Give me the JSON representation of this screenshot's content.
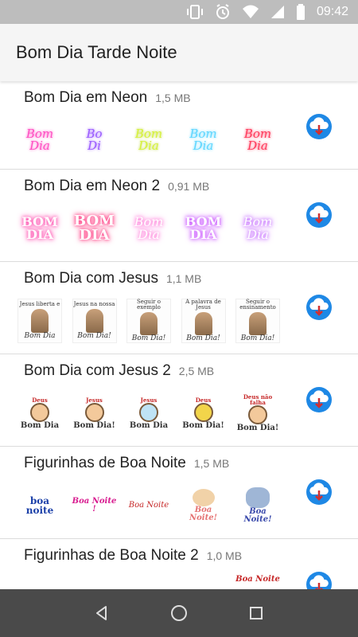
{
  "status": {
    "time": "09:42"
  },
  "app": {
    "title": "Bom Dia Tarde Noite"
  },
  "packs": [
    {
      "name": "Bom Dia em Neon",
      "size": "1,5 MB",
      "stickers": [
        {
          "l1": "Bom",
          "l2": "Dia",
          "color": "#ff4fc3"
        },
        {
          "l1": "Bo",
          "l2": "Di",
          "color": "#9b5cff"
        },
        {
          "l1": "Bom",
          "l2": "Dia",
          "color": "#d6f23a"
        },
        {
          "l1": "Bom",
          "l2": "Dia",
          "color": "#5ed6ff"
        },
        {
          "l1": "Bom",
          "l2": "Dia",
          "color": "#ff3b5c"
        }
      ]
    },
    {
      "name": "Bom Dia em Neon 2",
      "size": "0,91 MB",
      "stickers": [
        {
          "l1": "BOM",
          "l2": "DIA",
          "color": "#ff3ea8"
        },
        {
          "l1": "BOM",
          "l2": "DIA",
          "color": "#ff2f7a"
        },
        {
          "l1": "Bom",
          "l2": "Dia",
          "color": "#ff5fd0"
        },
        {
          "l1": "BOM",
          "l2": "DIA",
          "color": "#c445ff"
        },
        {
          "l1": "Bom",
          "l2": "Dia",
          "color": "#b94dff"
        }
      ]
    },
    {
      "name": "Bom Dia com Jesus",
      "size": "1,1 MB",
      "stickers": [
        {
          "l1": "Jesus liberta e",
          "l2": "Bom Dia"
        },
        {
          "l1": "Jesus na nossa",
          "l2": "Bom Dia!"
        },
        {
          "l1": "Seguir o exemplo",
          "l2": "Bom Dia!"
        },
        {
          "l1": "A palavra de Jesus",
          "l2": "Bom Dia!"
        },
        {
          "l1": "Seguir o ensinamento",
          "l2": "Bom Dia!"
        }
      ]
    },
    {
      "name": "Bom Dia com Jesus 2",
      "size": "2,5 MB",
      "stickers": [
        {
          "l1": "Deus",
          "l2": "Bom Dia"
        },
        {
          "l1": "Jesus",
          "l2": "Bom Dia!"
        },
        {
          "l1": "Jesus",
          "l2": "Bom Dia"
        },
        {
          "l1": "Deus",
          "l2": "Bom Dia!"
        },
        {
          "l1": "Deus não falha",
          "l2": "Bom Dia!"
        }
      ]
    },
    {
      "name": "Figurinhas de Boa Noite",
      "size": "1,5 MB",
      "stickers": [
        {
          "l1": "",
          "l2": "boa noite",
          "color": "#1a3fa8"
        },
        {
          "l1": "",
          "l2": "Boa Noite !",
          "color": "#d81b8f"
        },
        {
          "l1": "",
          "l2": "Boa Noite",
          "color": "#c62828"
        },
        {
          "l1": "",
          "l2": "Boa Noite!",
          "color": "#e57373"
        },
        {
          "l1": "",
          "l2": "Boa Noite!",
          "color": "#3949ab"
        }
      ]
    },
    {
      "name": "Figurinhas de Boa Noite 2",
      "size": "1,0 MB",
      "stickers": [
        {
          "l1": "",
          "l2": "",
          "color": "#c62828"
        },
        {
          "l1": "",
          "l2": "",
          "color": "#c62828"
        },
        {
          "l1": "",
          "l2": "",
          "color": "#c62828"
        },
        {
          "l1": "",
          "l2": "",
          "color": "#c62828"
        },
        {
          "l1": "",
          "l2": "Boa Noite",
          "color": "#c62828"
        }
      ]
    }
  ],
  "colors": {
    "accent": "#1e88e5",
    "statusbar": "#bdbdbd",
    "navbar": "#4a4a4a"
  },
  "nav": {
    "back_icon": "back-triangle-icon",
    "home_icon": "home-circle-icon",
    "recents_icon": "recents-square-icon"
  }
}
